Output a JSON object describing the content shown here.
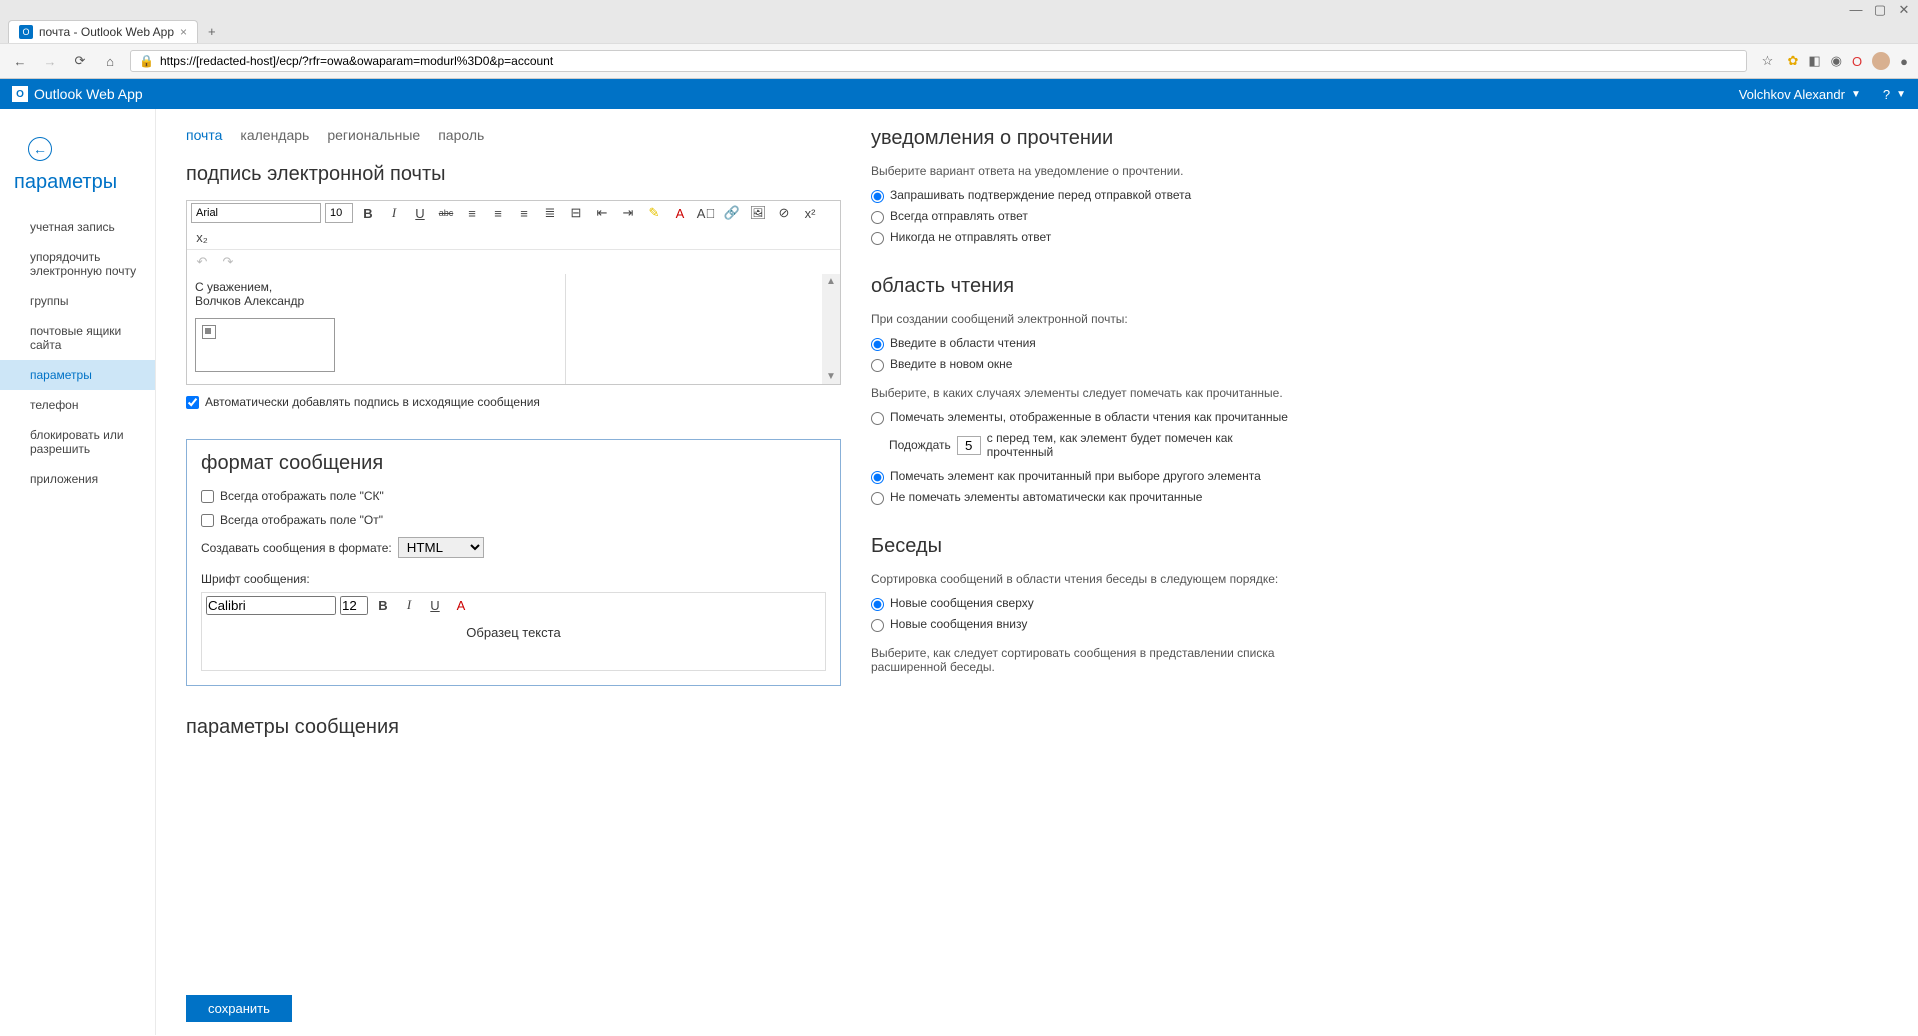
{
  "browser": {
    "tab_title": "почта - Outlook Web App",
    "url": "https://[redacted-host]/ecp/?rfr=owa&owaparam=modurl%3D0&p=account"
  },
  "app": {
    "name": "Outlook Web App",
    "user": "Volchkov Alexandr"
  },
  "sidebar": {
    "title": "параметры",
    "items": [
      {
        "label": "учетная запись"
      },
      {
        "label": "упорядочить электронную почту"
      },
      {
        "label": "группы"
      },
      {
        "label": "почтовые ящики сайта"
      },
      {
        "label": "параметры",
        "active": true
      },
      {
        "label": "телефон"
      },
      {
        "label": "блокировать или разрешить"
      },
      {
        "label": "приложения"
      }
    ]
  },
  "tabs": [
    {
      "label": "почта",
      "active": true
    },
    {
      "label": "календарь"
    },
    {
      "label": "региональные"
    },
    {
      "label": "пароль"
    }
  ],
  "signature": {
    "title": "подпись электронной почты",
    "font": "Arial",
    "size": "10",
    "line1": "С уважением,",
    "line2": "Волчков Александр",
    "auto_add_label": "Автоматически добавлять подпись в исходящие сообщения",
    "auto_add_checked": true
  },
  "format": {
    "title": "формат сообщения",
    "always_cc": "Всегда отображать поле \"СК\"",
    "always_from": "Всегда отображать поле \"От\"",
    "compose_label": "Создавать сообщения в формате:",
    "compose_value": "HTML",
    "font_label": "Шрифт сообщения:",
    "font": "Calibri",
    "size": "12",
    "sample": "Образец текста"
  },
  "msg_params": {
    "title": "параметры сообщения"
  },
  "read_receipts": {
    "title": "уведомления о прочтении",
    "desc": "Выберите вариант ответа на уведомление о прочтении.",
    "opt1": "Запрашивать подтверждение перед отправкой ответа",
    "opt2": "Всегда отправлять ответ",
    "opt3": "Никогда не отправлять ответ"
  },
  "reading_pane": {
    "title": "область чтения",
    "desc1": "При создании сообщений электронной почты:",
    "opt1": "Введите в области чтения",
    "opt2": "Введите в новом окне",
    "desc2": "Выберите, в каких случаях элементы следует помечать как прочитанные.",
    "opt3": "Помечать элементы, отображенные в области чтения как прочитанные",
    "wait_before": "Подождать",
    "wait_value": "5",
    "wait_after": "с перед тем, как элемент будет помечен как прочтенный",
    "opt4": "Помечать элемент как прочитанный при выборе другого элемента",
    "opt5": "Не помечать элементы автоматически как прочитанные"
  },
  "conversations": {
    "title": "Беседы",
    "desc1": "Сортировка сообщений в области чтения беседы в следующем порядке:",
    "opt1": "Новые сообщения сверху",
    "opt2": "Новые сообщения внизу",
    "desc2": "Выберите, как следует сортировать сообщения в представлении списка расширенной беседы."
  },
  "save": {
    "label": "сохранить"
  }
}
